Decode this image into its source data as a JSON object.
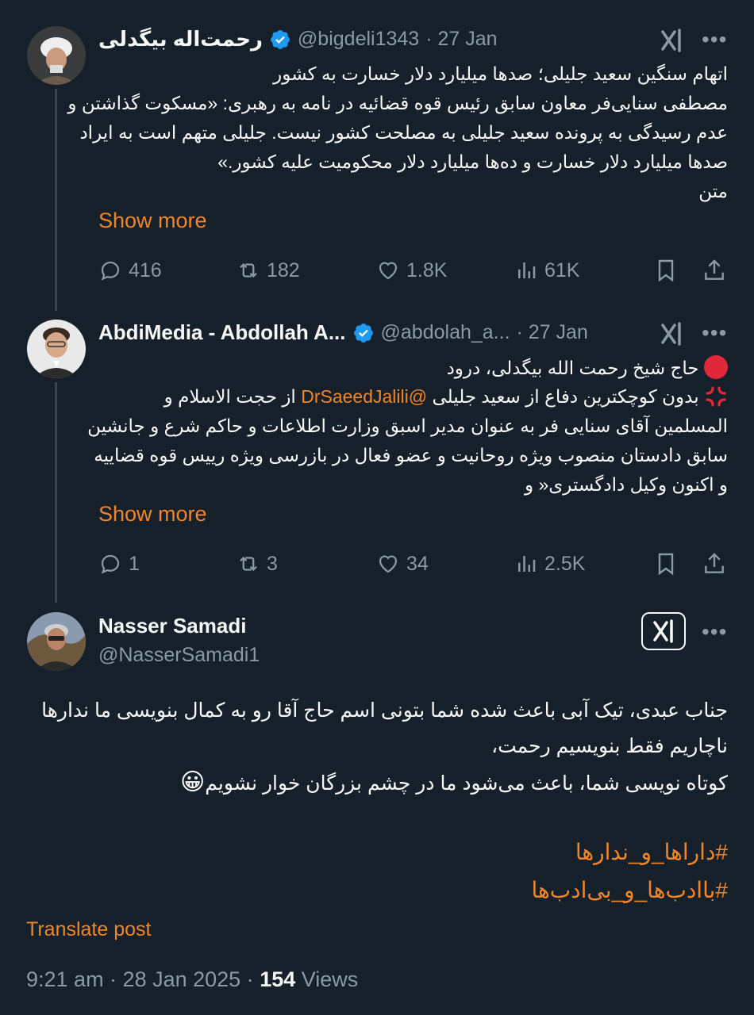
{
  "tweet1": {
    "name": "رحمت‌اله بیگدلی",
    "handle": "@bigdeli1343",
    "date": "· 27 Jan",
    "lines": [
      "اتهام سنگین سعید جلیلی؛ صدها میلیارد دلار خسارت به کشور",
      "مصطفی سنایی‌فر معاون سابق رئیس قوه قضائیه در نامه به رهبری: «مسکوت گذاشتن و",
      "عدم رسیدگی به پرونده سعید جلیلی به مصلحت کشور نیست. جلیلی متهم است به ایراد",
      "صدها میلیارد دلار خسارت و ده‌ها میلیارد دلار محکومیت علیه کشور.»",
      "متن"
    ],
    "show_more": "Show more",
    "replies": "416",
    "reposts": "182",
    "likes": "1.8K",
    "views": "61K"
  },
  "tweet2": {
    "name": "AbdiMedia - Abdollah A...",
    "handle": "@abdolah_a...",
    "date": "· 27 Jan",
    "line1": "حاج شیخ رحمت الله بیگدلی، درود",
    "line2_pre": "بدون کوچکترین دفاع از سعید جلیلی",
    "line2_mention": "@DrSaeedJalili",
    "line2_post": "از حجت الاسلام و",
    "line3": "المسلمین آقای سنایی فر به عنوان مدیر اسبق وزارت اطلاعات و حاکم شرع و جانشین",
    "line4": "سابق دادستان منصوب ویژه روحانیت و عضو فعال در بازرسی ویژه رییس قوه قضاییه",
    "line5": "و اکنون وکیل دادگستری« و",
    "show_more": "Show more",
    "replies": "1",
    "reposts": "3",
    "likes": "34",
    "views": "2.5K"
  },
  "tweet3": {
    "name": "Nasser Samadi",
    "handle": "@NasserSamadi1",
    "line1": "جناب عبدی، تیک آبی باعث شده شما بتونی اسم حاج آقا رو به کمال بنویسی ما ندارها",
    "line2": "ناچاریم فقط بنویسیم رحمت،",
    "line3": "کوتاه نویسی شما، باعث می‌شود ما در چشم بزرگان خوار نشویم",
    "emoji": "😀",
    "hashtag1": "#داراها_و_ندارها",
    "hashtag2": "#باادب‌ها_و_بی‌ادب‌ها",
    "translate": "Translate post",
    "time": "9:21 am · 28 Jan 2025 · ",
    "views_count": "154",
    "views_label": " Views"
  },
  "colors": {
    "background": "#15202b",
    "accent": "#f1852a",
    "muted": "#8b98a5",
    "verified": "#1d9bf0"
  }
}
